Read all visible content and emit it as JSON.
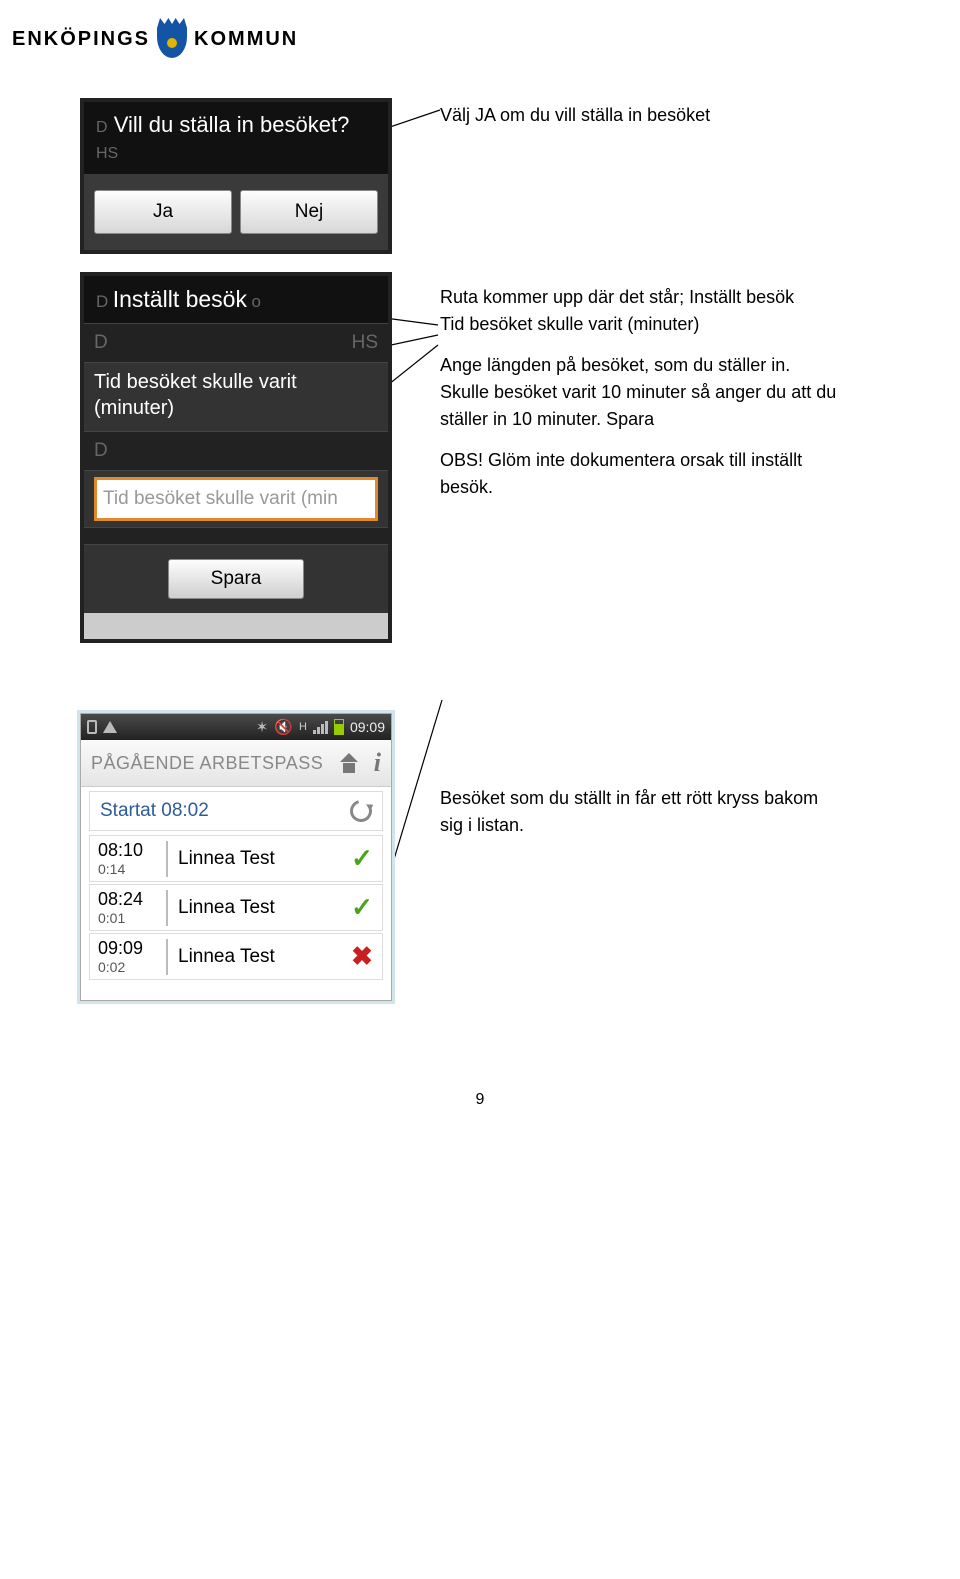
{
  "logo": {
    "left": "ENKÖPINGS",
    "right": "KOMMUN"
  },
  "caption1": "Välj JA om du vill ställa in besöket",
  "caption2_l1": "Ruta kommer upp där det står; Inställt besök",
  "caption2_l2": "Tid besöket skulle varit (minuter)",
  "caption2_p2": "Ange längden på besöket, som du ställer in. Skulle besöket varit 10 minuter så anger du att du ställer in 10 minuter. Spara",
  "caption2_p3": "OBS! Glöm inte dokumentera orsak till inställt besök.",
  "caption3": "Besöket som du ställt in får ett rött kryss bakom sig i listan.",
  "dialog": {
    "faint_left": "D",
    "title": "Vill du ställa in besöket?",
    "faint_right": "HS",
    "yes": "Ja",
    "no": "Nej"
  },
  "form": {
    "faint_left": "D",
    "title": "Inställt besök",
    "faint_right": "o",
    "darkrow1_left": "D",
    "darkrow1_right": "HS",
    "info": "Tid besöket skulle varit (minuter)",
    "darkrow2": "D",
    "input_value": "Tid besöket skulle varit (min",
    "save": "Spara"
  },
  "status": {
    "hnet": "H",
    "time": "09:09"
  },
  "appbar_title": "PÅGÅENDE ARBETSPASS",
  "startat": "Startat 08:02",
  "visits": [
    {
      "time": "08:10",
      "dur": "0:14",
      "name": "Linnea Test",
      "status": "ok"
    },
    {
      "time": "08:24",
      "dur": "0:01",
      "name": "Linnea Test",
      "status": "ok"
    },
    {
      "time": "09:09",
      "dur": "0:02",
      "name": "Linnea Test",
      "status": "cancelled"
    }
  ],
  "page_number": "9"
}
